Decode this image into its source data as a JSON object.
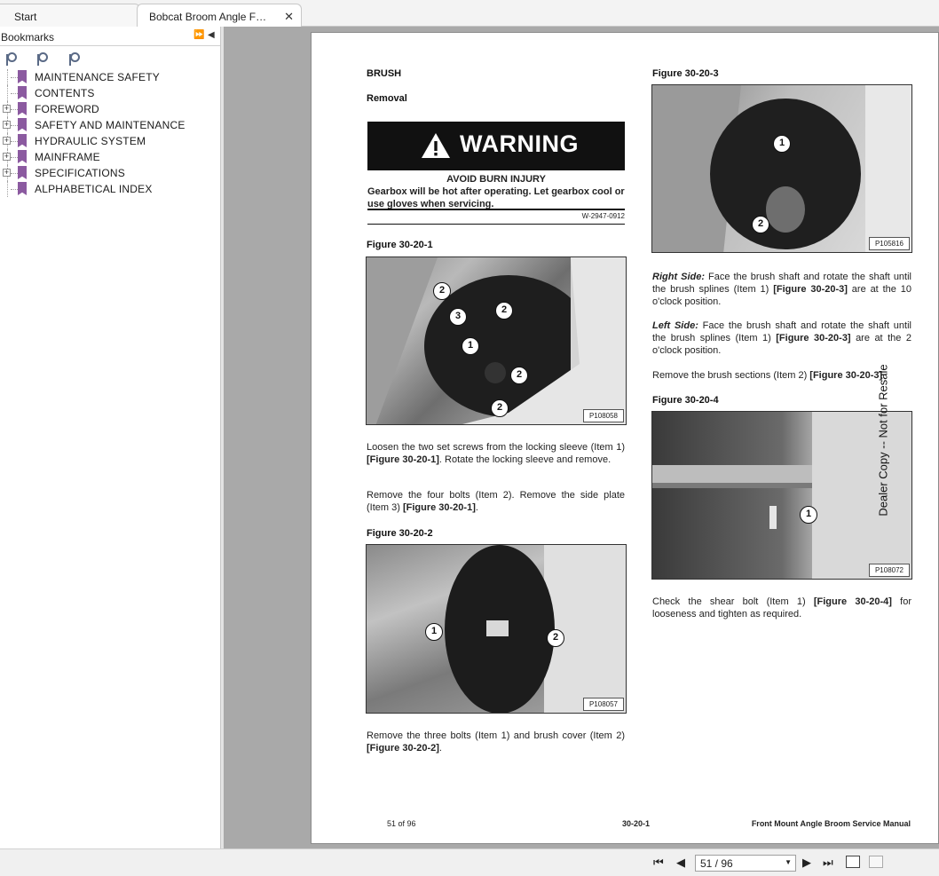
{
  "tabs": [
    {
      "label": "Start"
    },
    {
      "label": "Bobcat Broom  Angle F…",
      "close": "✕"
    }
  ],
  "sidebar": {
    "title": "Bookmarks",
    "items": [
      {
        "label": "MAINTENANCE SAFETY",
        "expandable": false
      },
      {
        "label": "CONTENTS",
        "expandable": false
      },
      {
        "label": "FOREWORD",
        "expandable": true
      },
      {
        "label": "SAFETY AND MAINTENANCE",
        "expandable": true
      },
      {
        "label": "HYDRAULIC SYSTEM",
        "expandable": true
      },
      {
        "label": "MAINFRAME",
        "expandable": true
      },
      {
        "label": "SPECIFICATIONS",
        "expandable": true
      },
      {
        "label": "ALPHABETICAL INDEX",
        "expandable": false
      }
    ]
  },
  "doc": {
    "heading": "BRUSH",
    "subheading": "Removal",
    "warning": {
      "title": "WARNING",
      "subtitle": "AVOID BURN INJURY",
      "text": "Gearbox will be hot after operating. Let gearbox cool or use gloves when servicing.",
      "code": "W-2947-0912"
    },
    "fig1": {
      "caption": "Figure 30-20-1",
      "label": "P108058",
      "callouts": [
        "2",
        "3",
        "2",
        "1",
        "2",
        "2"
      ]
    },
    "para1": {
      "a": "Loosen the two set screws from the locking sleeve (Item 1) ",
      "ref": "[Figure 30-20-1]",
      "b": ". Rotate the locking sleeve and remove."
    },
    "para2": {
      "a": "Remove the four bolts (Item 2). Remove the side plate (Item 3) ",
      "ref": "[Figure 30-20-1]",
      "b": "."
    },
    "fig2": {
      "caption": "Figure 30-20-2",
      "label": "P108057",
      "callouts": [
        "1",
        "2"
      ]
    },
    "para3": {
      "a": "Remove the three bolts (Item 1) and brush cover (Item 2) ",
      "ref": "[Figure 30-20-2]",
      "b": "."
    },
    "fig3": {
      "caption": "Figure 30-20-3",
      "label": "P105816",
      "callouts": [
        "1",
        "2"
      ]
    },
    "right_side": {
      "label": "Right Side:",
      "a": " Face the brush shaft and rotate the shaft until the brush splines (Item 1) ",
      "ref": "[Figure 30-20-3]",
      "b": " are at the 10 o'clock position."
    },
    "left_side": {
      "label": "Left Side:",
      "a": " Face the brush shaft and rotate the shaft until the brush splines (Item 1) ",
      "ref": "[Figure 30-20-3]",
      "b": " are at the 2 o'clock position."
    },
    "para4": {
      "a": "Remove the brush sections (Item 2) ",
      "ref": "[Figure 30-20-3]",
      "b": "."
    },
    "fig4": {
      "caption": "Figure 30-20-4",
      "label": "P108072",
      "callouts": [
        "1"
      ]
    },
    "para5": {
      "a": "Check the shear bolt (Item 1) ",
      "ref": "[Figure 30-20-4]",
      "b": " for looseness and tighten as required."
    },
    "footer": {
      "left": "51 of 96",
      "center": "30-20-1",
      "right": "Front Mount Angle Broom Service Manual"
    },
    "watermark": "Dealer Copy -- Not for Resale"
  },
  "nav": {
    "page_display": "51 / 96",
    "first": "⏮",
    "prev": "◀",
    "next": "▶",
    "last": "⏭"
  },
  "colors": {
    "bookmark": "#8b5aa0",
    "viewer_bg": "#a9a9a9"
  }
}
